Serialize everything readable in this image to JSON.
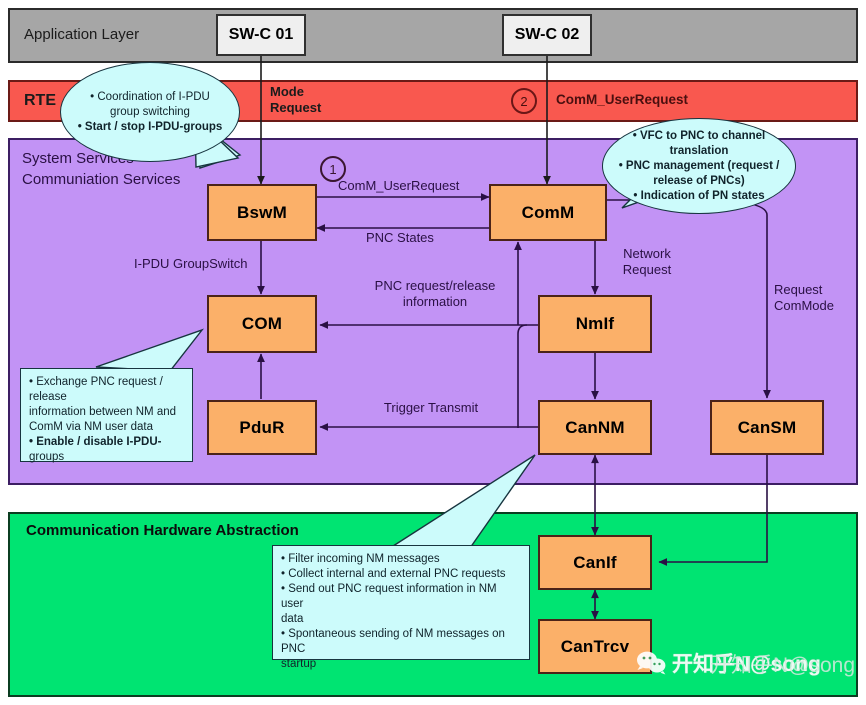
{
  "layers": {
    "application": {
      "title": "Application Layer"
    },
    "rte": {
      "title": "RTE"
    },
    "services": {
      "title": "System Services\nCommuniation Services"
    },
    "hardware": {
      "title": "Communication Hardware Abstraction"
    }
  },
  "swc": [
    {
      "id": "swc01",
      "label": "SW-C 01"
    },
    {
      "id": "swc02",
      "label": "SW-C 02"
    }
  ],
  "modules": [
    {
      "id": "bswm",
      "label": "BswM"
    },
    {
      "id": "comm",
      "label": "ComM"
    },
    {
      "id": "com",
      "label": "COM"
    },
    {
      "id": "nmif",
      "label": "NmIf"
    },
    {
      "id": "pdur",
      "label": "PduR"
    },
    {
      "id": "cannm",
      "label": "CanNM"
    },
    {
      "id": "cansm",
      "label": "CanSM"
    },
    {
      "id": "canif",
      "label": "CanIf"
    },
    {
      "id": "cantrcv",
      "label": "CanTrcv"
    }
  ],
  "steps": [
    {
      "id": "step1",
      "label": "1"
    },
    {
      "id": "step2",
      "label": "2"
    }
  ],
  "edge_labels": [
    {
      "id": "mode-request",
      "label": "Mode\nRequest"
    },
    {
      "id": "comm-userrequest-rte",
      "label": "ComM_UserRequest"
    },
    {
      "id": "comm-userrequest",
      "label": "ComM_UserRequest"
    },
    {
      "id": "pnc-states",
      "label": "PNC States"
    },
    {
      "id": "ipdu-groupswitch",
      "label": "I-PDU GroupSwitch"
    },
    {
      "id": "pnc-request-release",
      "label": "PNC request/release\ninformation"
    },
    {
      "id": "network-request",
      "label": "Network\nRequest"
    },
    {
      "id": "request-commode",
      "label": "Request\nComMode"
    },
    {
      "id": "trigger-transmit",
      "label": "Trigger Transmit"
    }
  ],
  "callouts": [
    {
      "id": "bswm-callout",
      "lines": [
        {
          "text": "• Coordination of I-PDU",
          "bold": false
        },
        {
          "text": "group switching",
          "bold": false
        },
        {
          "text": "• Start / stop I-PDU-groups",
          "bold": true
        }
      ]
    },
    {
      "id": "comm-callout",
      "lines": [
        {
          "text": "• VFC to PNC to channel",
          "bold": true
        },
        {
          "text": "translation",
          "bold": true
        },
        {
          "text": "• PNC management (request /",
          "bold": true
        },
        {
          "text": "release of PNCs)",
          "bold": true
        },
        {
          "text": "• Indication of PN states",
          "bold": true
        }
      ]
    },
    {
      "id": "com-callout",
      "lines": [
        {
          "text": "• Exchange PNC request /",
          "bold": false
        },
        {
          "text": "release",
          "bold": false
        },
        {
          "text": "information between NM and",
          "bold": false
        },
        {
          "text": "ComM via NM user data",
          "bold": false
        },
        {
          "text": "• Enable / disable I-PDU-",
          "bold": true
        },
        {
          "text": "groups",
          "bold": false
        }
      ]
    },
    {
      "id": "cannm-callout",
      "lines": [
        {
          "text": "• Filter incoming NM messages",
          "bold": false
        },
        {
          "text": "• Collect internal and external PNC requests",
          "bold": false
        },
        {
          "text": "• Send out PNC request information in NM user",
          "bold": false
        },
        {
          "text": "data",
          "bold": false
        },
        {
          "text": "• Spontaneous sending of NM messages on PNC",
          "bold": false
        },
        {
          "text": "startup",
          "bold": false
        }
      ]
    }
  ],
  "watermark": {
    "primary": "开知乎N@song",
    "secondary": "开知乎N@song"
  },
  "colors": {
    "application_layer": "#a6a6a6",
    "rte_layer": "#f9584f",
    "services_layer": "#c293f5",
    "hardware_layer": "#00e472",
    "module_box": "#fbb069",
    "callout": "#ccfbfb",
    "swc_box": "#efefef",
    "wire": "#2a1044"
  }
}
